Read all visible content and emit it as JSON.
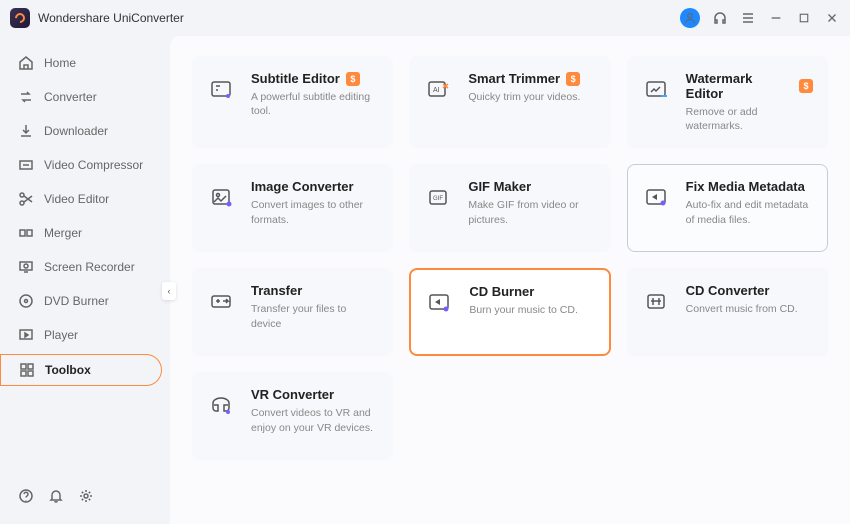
{
  "app": {
    "title": "Wondershare UniConverter"
  },
  "sidebar": {
    "items": [
      {
        "label": "Home"
      },
      {
        "label": "Converter"
      },
      {
        "label": "Downloader"
      },
      {
        "label": "Video Compressor"
      },
      {
        "label": "Video Editor"
      },
      {
        "label": "Merger"
      },
      {
        "label": "Screen Recorder"
      },
      {
        "label": "DVD Burner"
      },
      {
        "label": "Player"
      },
      {
        "label": "Toolbox"
      }
    ]
  },
  "tools": [
    {
      "title": "Subtitle Editor",
      "desc": "A powerful subtitle editing tool.",
      "badge": "$"
    },
    {
      "title": "Smart Trimmer",
      "desc": "Quicky trim your videos.",
      "badge": "$"
    },
    {
      "title": "Watermark Editor",
      "desc": "Remove or add watermarks.",
      "badge": "$"
    },
    {
      "title": "Image Converter",
      "desc": "Convert images to other formats."
    },
    {
      "title": "GIF Maker",
      "desc": "Make GIF from video or pictures."
    },
    {
      "title": "Fix Media Metadata",
      "desc": "Auto-fix and edit metadata of media files."
    },
    {
      "title": "Transfer",
      "desc": "Transfer your files to device"
    },
    {
      "title": "CD Burner",
      "desc": "Burn your music to CD."
    },
    {
      "title": "CD Converter",
      "desc": "Convert music from CD."
    },
    {
      "title": "VR Converter",
      "desc": "Convert videos to VR and enjoy on your VR devices."
    }
  ]
}
